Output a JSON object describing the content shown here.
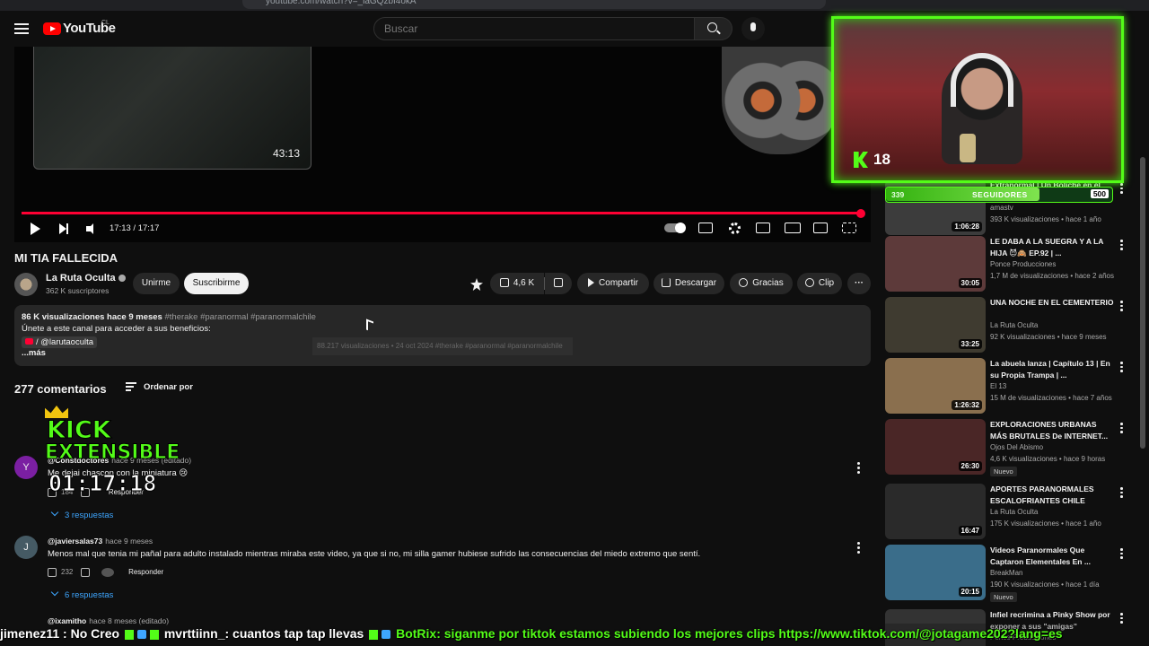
{
  "browser": {
    "url": "youtube.com/watch?v=_laGQzbI4okA"
  },
  "masthead": {
    "logo_text": "YouTube",
    "country": "CL",
    "search_placeholder": "Buscar"
  },
  "player": {
    "preview_time": "43:13",
    "time": "17:13 / 17:17",
    "progress_fraction": 1.0
  },
  "video": {
    "title": "MI TIA FALLECIDA",
    "channel": "La Ruta Oculta",
    "subscribers": "362 K suscriptores",
    "join_label": "Unirme",
    "subscribe_label": "Suscribirme",
    "likes": "4,6 K",
    "share_label": "Compartir",
    "download_label": "Descargar",
    "thanks_label": "Gracias",
    "clip_label": "Clip"
  },
  "description": {
    "views_date": "86 K visualizaciones  hace 9 meses",
    "tags": "#therake #paranormal #paranormalchile",
    "join_text": "Únete a este canal para acceder a sus beneficios:",
    "link": "/ @larutaoculta",
    "more": "...más",
    "ghost_text": "88.217 visualizaciones • 24 oct 2024  #therake #paranormal #paranormalchile"
  },
  "comments": {
    "count": "277 comentarios",
    "sort_label": "Ordenar por",
    "items": [
      {
        "avatar": "Y",
        "avatar_color": "#7b1fa2",
        "author": "@Constdoctores",
        "when": "hace 9 meses (editado)",
        "text": "Me dejai chascon con la miniatura 😢",
        "likes": "184",
        "reply": "Responder",
        "replies": "3 respuestas"
      },
      {
        "avatar": "J",
        "avatar_color": "#455a64",
        "author": "@javiersalas73",
        "when": "hace 9 meses",
        "text": "Menos mal que tenia mi pañal para adulto instalado mientras miraba este video, ya que si no, mi silla gamer hubiese sufrido las consecuencias del miedo extremo que sentí.",
        "likes": "232",
        "reply": "Responder",
        "replies": "6 respuestas"
      },
      {
        "author": "@ixamitho",
        "when": "hace 8 meses (editado)"
      }
    ]
  },
  "overlay": {
    "title": "KICK",
    "subtitle": "EXTENSIBLE",
    "clock": "01:17:18"
  },
  "webcam": {
    "viewers": "18",
    "followers_current": "339",
    "followers_label": "SEGUIDORES",
    "followers_goal": "500",
    "followers_fraction": 0.678
  },
  "sidebar": [
    {
      "title": "Extranormal | Un Boliche en el bosque",
      "channel": "amastv",
      "meta": "393 K visualizaciones • hace 1 año",
      "duration": "1:06:28",
      "thumb": "#3c3c3c"
    },
    {
      "title": "LE DABA A LA SUEGRA Y A LA HIJA 😈🙈 EP.92 | ...",
      "channel": "Ponce Producciones",
      "meta": "1,7 M de visualizaciones • hace 2 años",
      "duration": "30:05",
      "thumb": "#5d3a3a"
    },
    {
      "title": "UNA NOCHE EN EL CEMENTERIO",
      "channel": "La Ruta Oculta",
      "meta": "92 K visualizaciones • hace 9 meses",
      "duration": "33:25",
      "thumb": "#3f3b30"
    },
    {
      "title": "La abuela lanza | Capítulo 13 | En su Propia Trampa | ...",
      "channel": "El 13",
      "meta": "15 M de visualizaciones • hace 7 años",
      "duration": "1:26:32",
      "thumb": "#8a6f4e"
    },
    {
      "title": "EXPLORACIONES URBANAS MÁS BRUTALES De INTERNET...",
      "channel": "Ojos Del Abismo",
      "meta": "4,6 K visualizaciones • hace 9 horas",
      "badge": "Nuevo",
      "duration": "26:30",
      "thumb": "#4a2626"
    },
    {
      "title": "APORTES PARANORMALES ESCALOFRIANTES CHILE",
      "channel": "La Ruta Oculta",
      "meta": "175 K visualizaciones • hace 1 año",
      "duration": "16:47",
      "thumb": "#2a2a2a"
    },
    {
      "title": "Videos Paranormales Que Captaron Elementales En ...",
      "channel": "BreakMan",
      "meta": "190 K visualizaciones • hace 1 día",
      "badge": "Nuevo",
      "duration": "20:15",
      "thumb": "#3a6d8a"
    },
    {
      "title": "Infiel recrimina a Pinky Show por exponer a sus \"amigas\"",
      "channel": "Ponce Producciones",
      "meta": "",
      "duration": "",
      "thumb": "#333"
    }
  ],
  "chat": {
    "m1": "jimenez11 : No Creo",
    "m2": "mvrttiinn_: cuantos tap tap llevas",
    "m3": "BotRix: siganme por tiktok estamos subiendo los mejores clips https://www.tiktok.com/@jotagame202?lang=es"
  }
}
